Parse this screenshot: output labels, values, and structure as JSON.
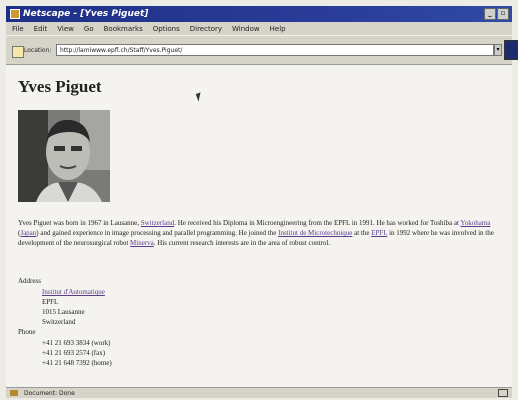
{
  "window": {
    "title": "Netscape - [Yves Piguet]"
  },
  "menu": [
    "File",
    "Edit",
    "View",
    "Go",
    "Bookmarks",
    "Options",
    "Directory",
    "Window",
    "Help"
  ],
  "location": {
    "label": "Location:",
    "url": "http://lamiwww.epfl.ch/Staff/Yves.Piguet/"
  },
  "page": {
    "title": "Yves Piguet",
    "bio": {
      "p1": "Yves Piguet was born in 1967 in Lausanne, ",
      "switzerland": "Switzerland",
      "p2": ". He received his Diploma in Microengineering from the EPFL in 1991. He has worked for Toshiba at ",
      "yokohama": "Yokohama",
      "p3": " (",
      "japan": "Japan",
      "p4": ") and gained experience in image processing and parallel programming. He joined the ",
      "institut": "Institut de Microtechnique",
      "p5": " at the ",
      "epfl": "EPFL",
      "p6": " in 1992 where he was involved in the development of the neurosurgical robot ",
      "minerva": "Minerva",
      "p7": ". His current research interests are in the area of robust control."
    },
    "address": {
      "label": "Address",
      "lines": [
        "Institut d'Automatique",
        "EPFL",
        "1015 Lausanne",
        "Switzerland"
      ]
    },
    "phone": {
      "label": "Phone",
      "lines": [
        "+41 21 693 3834 (work)",
        "+41 21 693 2574 (fax)",
        "+41 21 648 7392 (home)"
      ]
    }
  },
  "status": {
    "text": "Document: Done"
  }
}
